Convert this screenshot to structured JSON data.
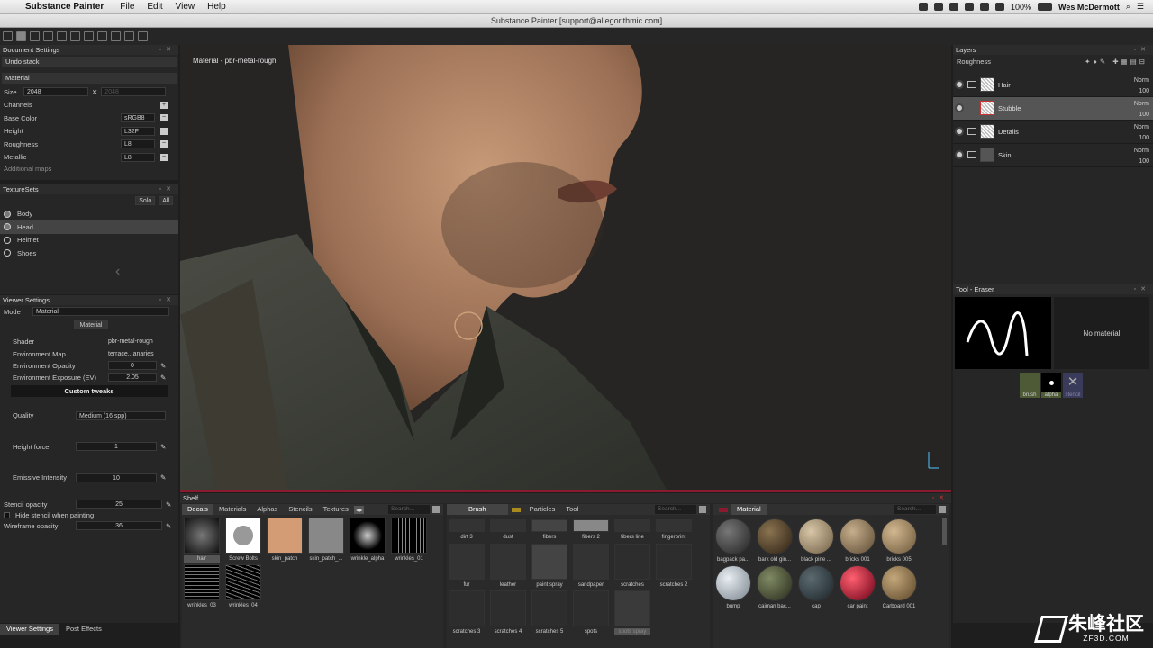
{
  "menubar": {
    "app_name": "Substance Painter",
    "menus": [
      "File",
      "Edit",
      "View",
      "Help"
    ],
    "battery": "100%",
    "user": "Wes McDermott"
  },
  "window": {
    "title": "Substance Painter [support@allegorithmic.com]"
  },
  "document_settings": {
    "title": "Document Settings",
    "undo_stack": "Undo stack",
    "material_label": "Material",
    "size_label": "Size",
    "size_value": "2048",
    "size_value_2": "2048",
    "channels_label": "Channels",
    "channels": [
      {
        "name": "Base Color",
        "format": "sRGB8"
      },
      {
        "name": "Height",
        "format": "L32F"
      },
      {
        "name": "Roughness",
        "format": "L8"
      },
      {
        "name": "Metallic",
        "format": "L8"
      }
    ],
    "additional_maps": "Additional maps"
  },
  "texture_sets": {
    "title": "TextureSets",
    "solo": "Solo",
    "all": "All",
    "items": [
      "Body",
      "Head",
      "Helmet",
      "Shoes"
    ]
  },
  "viewer_settings": {
    "title": "Viewer Settings",
    "mode_label": "Mode",
    "mode_value": "Material",
    "material_button": "Material",
    "shader_label": "Shader",
    "shader_value": "pbr-metal-rough",
    "env_map_label": "Environment Map",
    "env_map_value": "terrace...anaries",
    "env_opacity_label": "Environment Opacity",
    "env_opacity_value": "0",
    "env_exposure_label": "Environment Exposure (EV)",
    "env_exposure_value": "2.05",
    "custom_tweaks": "Custom tweaks",
    "quality_label": "Quality",
    "quality_value": "Medium (16 spp)",
    "height_force_label": "Height force",
    "height_force_value": "1",
    "emissive_label": "Emissive Intensity",
    "emissive_value": "10",
    "stencil_opacity_label": "Stencil opacity",
    "stencil_opacity_value": "25",
    "hide_stencil_label": "Hide stencil when painting",
    "wireframe_label": "Wireframe opacity",
    "wireframe_value": "36"
  },
  "bottom_tabs": [
    "Viewer Settings",
    "Post Effects"
  ],
  "viewport": {
    "label": "Material - pbr-metal-rough"
  },
  "layers": {
    "title": "Layers",
    "channel": "Roughness",
    "items": [
      {
        "name": "Hair",
        "blend": "Norm",
        "opacity": "100"
      },
      {
        "name": "Stubble",
        "blend": "Norm",
        "opacity": "100"
      },
      {
        "name": "Details",
        "blend": "Norm",
        "opacity": "100"
      },
      {
        "name": "Skin",
        "blend": "Norm",
        "opacity": "100"
      }
    ]
  },
  "tool_panel": {
    "title": "Tool - Eraser",
    "no_material": "No material",
    "slots": [
      "brush",
      "alpha",
      "stencil"
    ]
  },
  "shelf": {
    "title": "Shelf",
    "tabs": [
      "Decals",
      "Materials",
      "Alphas",
      "Stencils",
      "Textures"
    ],
    "search_placeholder": "Search...",
    "decals": [
      "hair",
      "Screw Bolts",
      "skin_patch",
      "skin_patch_...",
      "wrinkle_alpha",
      "wrinkles_01",
      "wrinkles_03",
      "wrinkles_04"
    ],
    "brush_tabs": [
      "Brush",
      "Particles",
      "Tool"
    ],
    "brushes": [
      "dirt 3",
      "dust",
      "fibers",
      "fibers 2",
      "fibers line",
      "fingerprint",
      "fur",
      "leather",
      "paint spray",
      "sandpaper",
      "scratches",
      "scratches 2",
      "scratches 3",
      "scratches 4",
      "scratches 5",
      "spots",
      "spots spray"
    ],
    "material_tab": "Material",
    "materials": [
      "bagpack pa...",
      "bark old gin...",
      "black pine ...",
      "bricks 001",
      "bricks 005",
      "bump",
      "caiman bac...",
      "cap",
      "car paint",
      "Carboard 001"
    ]
  },
  "watermark": {
    "main": "朱峰社区",
    "sub": "ZF3D.COM"
  },
  "colors": {
    "accent_red": "#8a1a2e",
    "panel_bg": "#262626",
    "selected_row": "#555555"
  }
}
